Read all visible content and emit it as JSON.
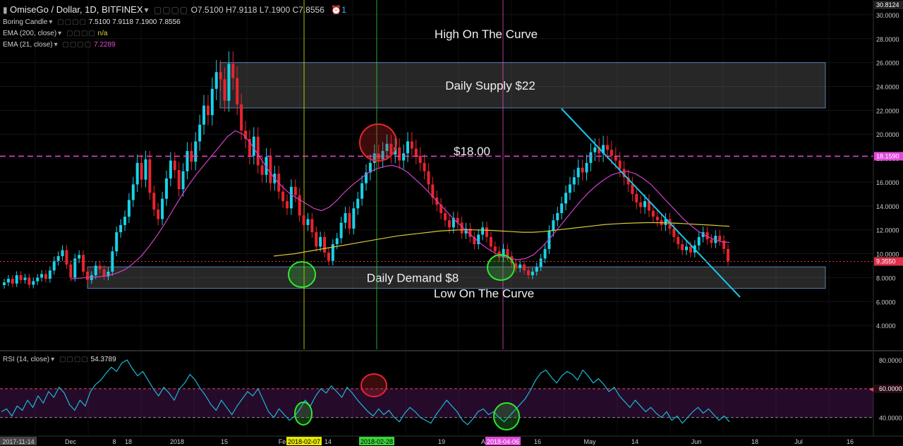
{
  "header": {
    "symbol": "OmiseGo / Dollar, 1D, BITFINEX",
    "ohlc": "O7.5100  H7.9118  L7.1900  C7.8556",
    "alerts": "1"
  },
  "indicators": [
    {
      "label": "Boring Candle",
      "values": "7.5100  7.9118  7.1900  7.8556",
      "color": "#e0e0e0"
    },
    {
      "label": "EMA (200, close)",
      "values": "n/a",
      "color": "#e6d33a"
    },
    {
      "label": "EMA (21, close)",
      "values": "7.2289",
      "color": "#e04ad8"
    }
  ],
  "rsi_header": {
    "label": "RSI (14, close)",
    "value": "54.3789"
  },
  "chart_data": {
    "type": "candlestick",
    "price_axis": {
      "ticks": [
        "4.0000",
        "6.0000",
        "8.0000",
        "10.0000",
        "12.0000",
        "14.0000",
        "16.0000",
        "18.0000",
        "20.0000",
        "22.0000",
        "24.0000",
        "26.0000",
        "28.0000",
        "30.0000"
      ],
      "top_label": "30.8124",
      "range": [
        2.0,
        31.0
      ]
    },
    "price_markers": [
      {
        "value": 18.159,
        "label": "18.1590",
        "color": "#e04ad8"
      },
      {
        "value": 9.355,
        "label": "9.3550",
        "color": "#e0304a"
      }
    ],
    "zones": [
      {
        "label": "Daily Supply $22",
        "from": 22.2,
        "to": 26.0
      },
      {
        "label": "Daily Demand $8",
        "from": 7.1,
        "to": 8.9
      }
    ],
    "annotations": [
      {
        "text": "High On The Curve",
        "price": 28.4
      },
      {
        "text": "$18.00",
        "price": 18.6
      },
      {
        "text": "Low On The Curve",
        "price": 6.7
      }
    ],
    "time_axis": {
      "labels": [
        "2017-11-14",
        "Dec",
        "8",
        "18",
        "2018",
        "15",
        "Fe",
        "14",
        "19",
        "A",
        "16",
        "May",
        "14",
        "Jun",
        "18",
        "Jul",
        "16"
      ],
      "highlight_dates": [
        {
          "label": "2018-02-07",
          "color": "#e6e600"
        },
        {
          "label": "2018-02-28",
          "color": "#3ad43a"
        },
        {
          "label": "2018-04-06",
          "color": "#e04ad8"
        }
      ]
    },
    "rsi": {
      "ticks": [
        "40.0000",
        "60.0000",
        "80.0000"
      ],
      "marker": {
        "value": 60.0,
        "label": "60.0000"
      },
      "band": [
        40,
        60
      ],
      "range": [
        28,
        84
      ]
    },
    "series_points": {
      "close": [
        7.6,
        7.9,
        7.5,
        8.2,
        7.8,
        8.0,
        7.4,
        7.7,
        8.0,
        8.3,
        7.9,
        8.6,
        9.4,
        9.8,
        10.3,
        9.1,
        8.0,
        9.6,
        9.9,
        8.5,
        7.8,
        8.2,
        9.0,
        8.7,
        8.1,
        8.5,
        10.2,
        11.8,
        12.4,
        13.1,
        14.5,
        15.8,
        17.6,
        16.2,
        17.9,
        15.1,
        13.7,
        12.9,
        14.6,
        16.3,
        17.8,
        17.0,
        15.4,
        16.9,
        18.6,
        17.7,
        19.4,
        20.8,
        22.4,
        21.6,
        23.8,
        25.2,
        24.6,
        22.8,
        25.9,
        24.7,
        22.5,
        20.3,
        19.6,
        18.2,
        19.8,
        17.4,
        16.6,
        18.1,
        15.9,
        16.7,
        15.2,
        14.4,
        13.8,
        15.6,
        14.9,
        13.2,
        12.4,
        12.9,
        11.8,
        10.6,
        11.4,
        10.1,
        9.4,
        10.8,
        11.3,
        12.6,
        13.4,
        12.1,
        13.8,
        14.6,
        15.9,
        16.8,
        17.6,
        18.4,
        17.9,
        18.6,
        19.2,
        18.3,
        18.9,
        17.8,
        18.4,
        19.4,
        18.8,
        18.2,
        17.6,
        16.9,
        15.8,
        14.7,
        14.1,
        13.4,
        12.8,
        12.2,
        13.0,
        12.6,
        11.7,
        12.1,
        11.4,
        10.8,
        11.6,
        12.2,
        11.4,
        10.6,
        10.2,
        9.7,
        10.4,
        9.8,
        9.2,
        8.8,
        9.1,
        8.6,
        8.2,
        8.5,
        8.9,
        9.6,
        10.4,
        11.9,
        12.8,
        13.4,
        14.2,
        15.1,
        15.8,
        16.4,
        17.2,
        16.8,
        17.6,
        18.5,
        18.9,
        18.4,
        19.1,
        18.7,
        18.2,
        17.8,
        17.1,
        16.4,
        15.8,
        15.0,
        14.3,
        13.9,
        14.4,
        13.6,
        13.1,
        12.8,
        12.4,
        12.9,
        12.1,
        11.4,
        10.8,
        10.3,
        10.6,
        10.1,
        10.7,
        11.4,
        11.8,
        11.2,
        10.9,
        11.5,
        11.1,
        10.4,
        9.36
      ],
      "ema200": [
        9.8,
        9.9,
        10.0,
        10.15,
        10.3,
        10.45,
        10.6,
        10.75,
        10.9,
        11.05,
        11.2,
        11.35,
        11.5,
        11.6,
        11.7,
        11.8,
        11.9,
        11.95,
        12.0,
        12.0,
        11.98,
        11.95,
        11.9,
        11.85,
        11.8,
        11.8,
        11.85,
        11.95,
        12.05,
        12.15,
        12.25,
        12.35,
        12.45,
        12.5,
        12.55,
        12.58,
        12.6,
        12.6,
        12.58,
        12.55,
        12.5,
        12.45,
        12.4,
        12.35,
        12.3
      ],
      "rsi": [
        44,
        46,
        41,
        48,
        45,
        52,
        47,
        55,
        50,
        58,
        54,
        61,
        57,
        49,
        45,
        52,
        48,
        58,
        63,
        66,
        71,
        75,
        72,
        78,
        80,
        74,
        69,
        72,
        66,
        60,
        55,
        61,
        57,
        52,
        60,
        64,
        70,
        66,
        60,
        55,
        49,
        45,
        52,
        47,
        42,
        48,
        53,
        58,
        55,
        60,
        52,
        44,
        40,
        46,
        42,
        38,
        41,
        46,
        52,
        48,
        55,
        60,
        57,
        62,
        58,
        54,
        61,
        57,
        52,
        48,
        44,
        41,
        46,
        42,
        45,
        40,
        37,
        43,
        47,
        44,
        40,
        38,
        36,
        42,
        47,
        52,
        48,
        44,
        38,
        35,
        39,
        44,
        46,
        42,
        44,
        40,
        37,
        41,
        45,
        49,
        53,
        59,
        66,
        71,
        73,
        68,
        64,
        69,
        72,
        70,
        66,
        73,
        69,
        64,
        67,
        63,
        58,
        61,
        55,
        51,
        47,
        52,
        48,
        44,
        47,
        43,
        40,
        44,
        38,
        41,
        36,
        40,
        44,
        47,
        43,
        46,
        42,
        38,
        41,
        37
      ],
      "ema21": [
        7.9,
        7.95,
        8.0,
        8.05,
        8.1,
        8.2,
        8.4,
        8.7,
        9.2,
        9.8,
        10.6,
        11.5,
        12.5,
        13.6,
        14.7,
        15.7,
        16.6,
        17.4,
        18.2,
        19.0,
        19.8,
        20.3,
        20.0,
        19.2,
        18.2,
        17.2,
        16.3,
        15.6,
        15.0,
        14.6,
        14.2,
        13.8,
        13.6,
        13.9,
        14.5,
        15.2,
        15.8,
        16.3,
        16.8,
        17.1,
        17.3,
        17.4,
        17.2,
        16.8,
        16.2,
        15.6,
        14.9,
        14.2,
        13.5,
        12.8,
        12.2,
        11.6,
        11.0,
        10.5,
        10.1,
        9.8,
        9.6,
        9.5,
        9.6,
        9.9,
        10.5,
        11.2,
        12.0,
        12.8,
        13.6,
        14.4,
        15.1,
        15.7,
        16.2,
        16.6,
        16.8,
        16.9,
        16.7,
        16.3,
        15.8,
        15.1,
        14.4,
        13.7,
        13.0,
        12.4,
        11.9,
        11.5,
        11.2,
        11.0,
        10.95
      ]
    }
  }
}
